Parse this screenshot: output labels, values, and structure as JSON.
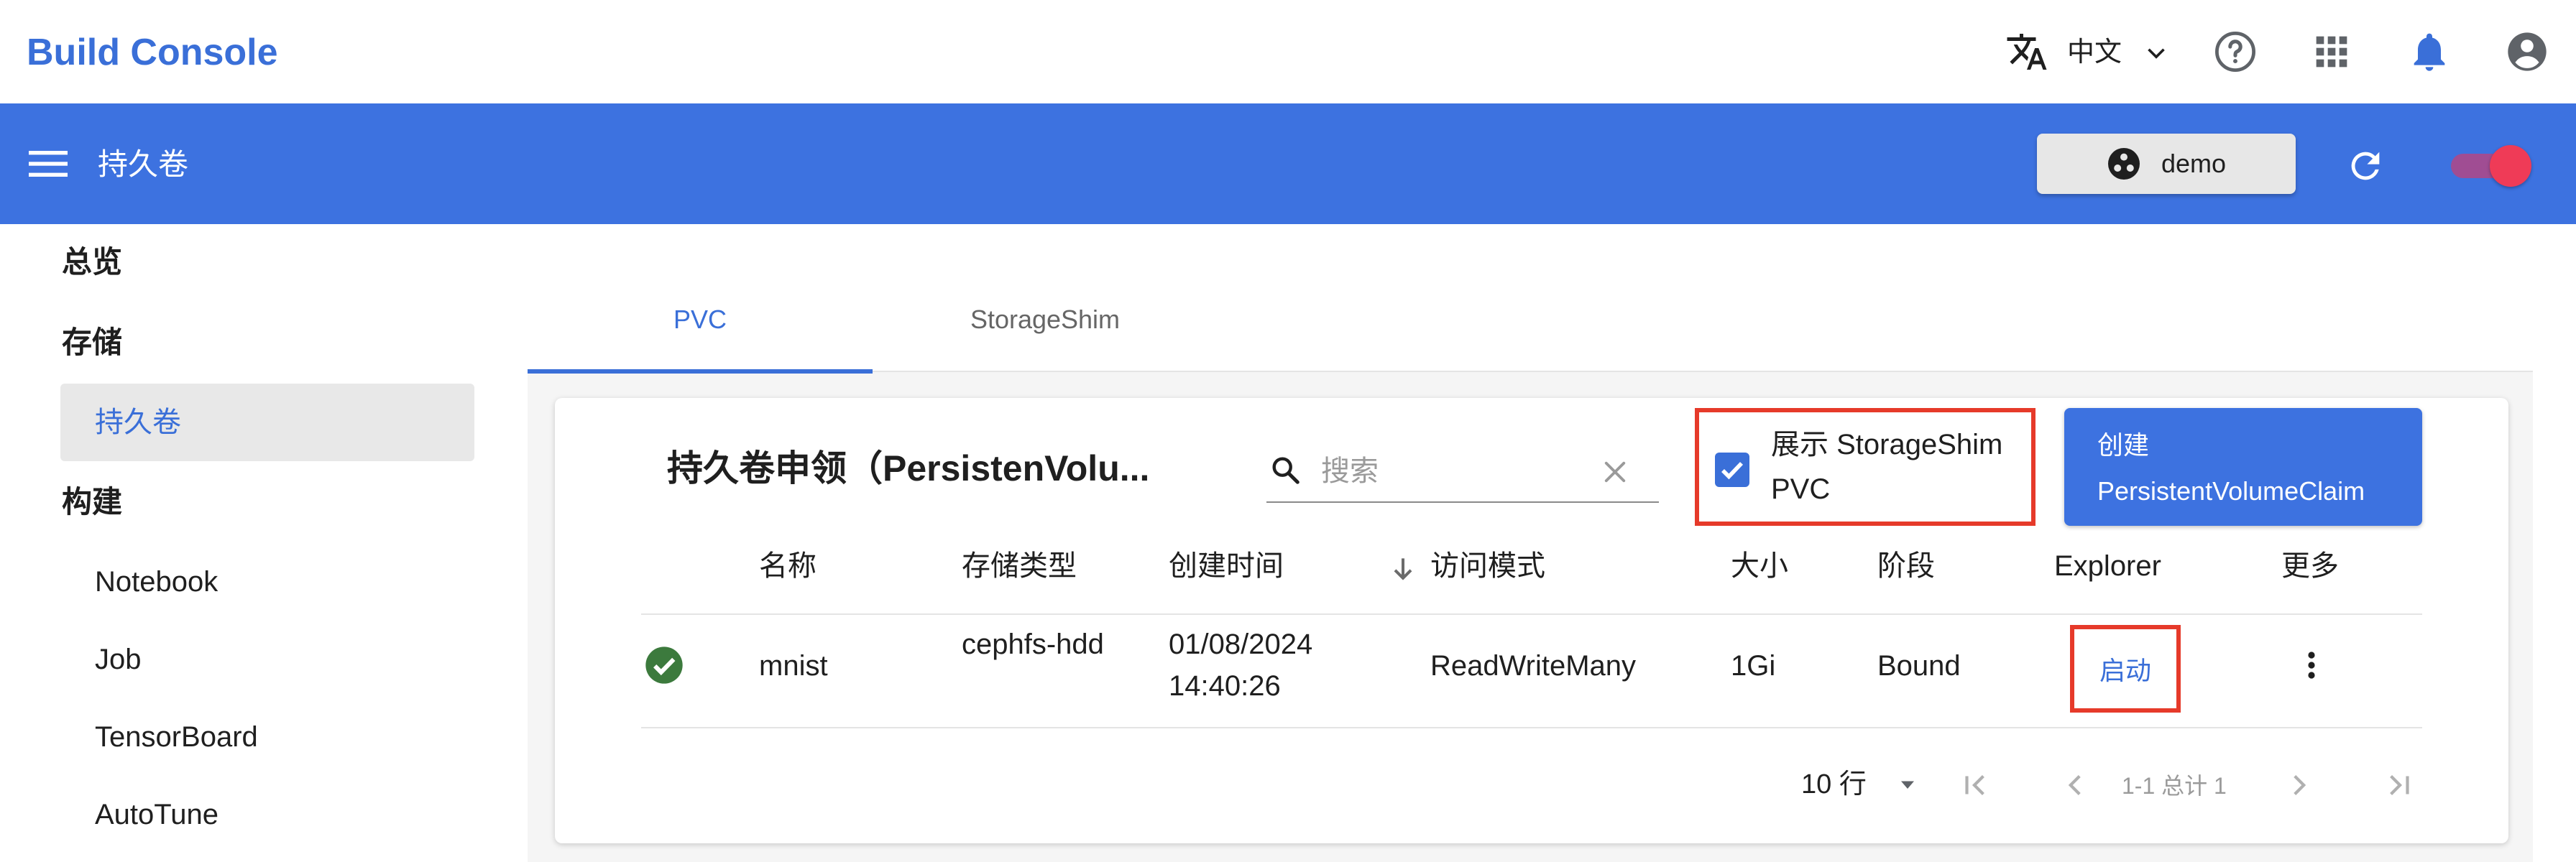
{
  "header": {
    "app_title": "Build Console",
    "language_label": "中文",
    "icons": [
      "translate-icon",
      "chevron-down-icon",
      "help-icon",
      "apps-grid-icon",
      "notification-bell-icon",
      "account-icon"
    ]
  },
  "appbar": {
    "section_title": "持久卷",
    "namespace_label": "demo"
  },
  "sidebar": {
    "groups": [
      {
        "label": "总览"
      },
      {
        "label": "存储",
        "items": [
          {
            "label": "持久卷",
            "active": true
          }
        ]
      },
      {
        "label": "构建",
        "items": [
          {
            "label": "Notebook"
          },
          {
            "label": "Job"
          },
          {
            "label": "TensorBoard"
          },
          {
            "label": "AutoTune"
          }
        ]
      }
    ]
  },
  "tabs": [
    {
      "label": "PVC",
      "active": true
    },
    {
      "label": "StorageShim",
      "active": false
    }
  ],
  "card": {
    "title": "持久卷申领（PersistenVolu...",
    "search_placeholder": "搜索",
    "search_value": "",
    "show_shim_label": "展示 StorageShim PVC",
    "show_shim_checked": true,
    "create_label": "创建 PersistentVolumeClaim"
  },
  "table": {
    "columns": [
      "名称",
      "存储类型",
      "创建时间",
      "访问模式",
      "大小",
      "阶段",
      "Explorer",
      "更多"
    ],
    "sort_column": "创建时间",
    "rows": [
      {
        "status": "ok",
        "name": "mnist",
        "storage_type": "cephfs-hdd",
        "created_date": "01/08/2024",
        "created_time": "14:40:26",
        "access_mode": "ReadWriteMany",
        "size": "1Gi",
        "phase": "Bound",
        "explorer_action": "启动"
      }
    ]
  },
  "pagination": {
    "rows_per_page_label": "10 行",
    "range_label": "1-1 总计 1"
  },
  "colors": {
    "brand_blue": "#3d72e0",
    "link_blue": "#3a6fd8",
    "highlight_red": "#e63a2a",
    "status_green": "#3c7a3d",
    "toggle_red": "#ef3b57"
  }
}
